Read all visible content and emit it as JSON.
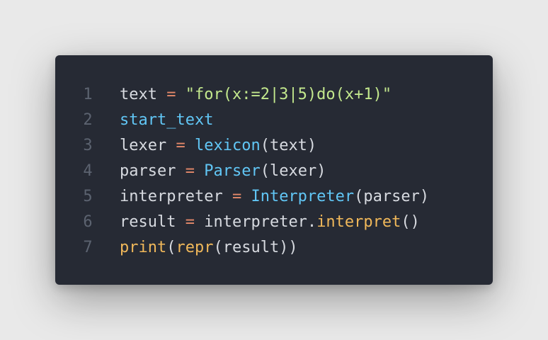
{
  "code": {
    "lines": [
      {
        "number": "1",
        "tokens": [
          {
            "text": "text",
            "kind": "plain"
          },
          {
            "text": " ",
            "kind": "plain"
          },
          {
            "text": "=",
            "kind": "op"
          },
          {
            "text": " ",
            "kind": "plain"
          },
          {
            "text": "\"for(x:=2|3|5)do(x+1)\"",
            "kind": "str"
          }
        ]
      },
      {
        "number": "2",
        "tokens": [
          {
            "text": "start_text",
            "kind": "fn"
          }
        ]
      },
      {
        "number": "3",
        "tokens": [
          {
            "text": "lexer",
            "kind": "plain"
          },
          {
            "text": " ",
            "kind": "plain"
          },
          {
            "text": "=",
            "kind": "op"
          },
          {
            "text": " ",
            "kind": "plain"
          },
          {
            "text": "lexicon",
            "kind": "fn"
          },
          {
            "text": "(text)",
            "kind": "plain"
          }
        ]
      },
      {
        "number": "4",
        "tokens": [
          {
            "text": "parser",
            "kind": "plain"
          },
          {
            "text": " ",
            "kind": "plain"
          },
          {
            "text": "=",
            "kind": "op"
          },
          {
            "text": " ",
            "kind": "plain"
          },
          {
            "text": "Parser",
            "kind": "fn"
          },
          {
            "text": "(lexer)",
            "kind": "plain"
          }
        ]
      },
      {
        "number": "5",
        "tokens": [
          {
            "text": "interpreter",
            "kind": "plain"
          },
          {
            "text": " ",
            "kind": "plain"
          },
          {
            "text": "=",
            "kind": "op"
          },
          {
            "text": " ",
            "kind": "plain"
          },
          {
            "text": "Interpreter",
            "kind": "fn"
          },
          {
            "text": "(parser)",
            "kind": "plain"
          }
        ]
      },
      {
        "number": "6",
        "tokens": [
          {
            "text": "result",
            "kind": "plain"
          },
          {
            "text": " ",
            "kind": "plain"
          },
          {
            "text": "=",
            "kind": "op"
          },
          {
            "text": " ",
            "kind": "plain"
          },
          {
            "text": "interpreter.",
            "kind": "plain"
          },
          {
            "text": "interpret",
            "kind": "method"
          },
          {
            "text": "()",
            "kind": "plain"
          }
        ]
      },
      {
        "number": "7",
        "tokens": [
          {
            "text": "print",
            "kind": "builtin"
          },
          {
            "text": "(",
            "kind": "plain"
          },
          {
            "text": "repr",
            "kind": "builtin"
          },
          {
            "text": "(result))",
            "kind": "plain"
          }
        ]
      }
    ]
  },
  "colors": {
    "background": "#e9e9e9",
    "editor_background": "#262a34",
    "line_number": "#5c6370",
    "plain": "#d7dae0",
    "operator": "#e5896a",
    "string": "#c3e88d",
    "function": "#61c6f5",
    "method": "#f0b85a"
  }
}
